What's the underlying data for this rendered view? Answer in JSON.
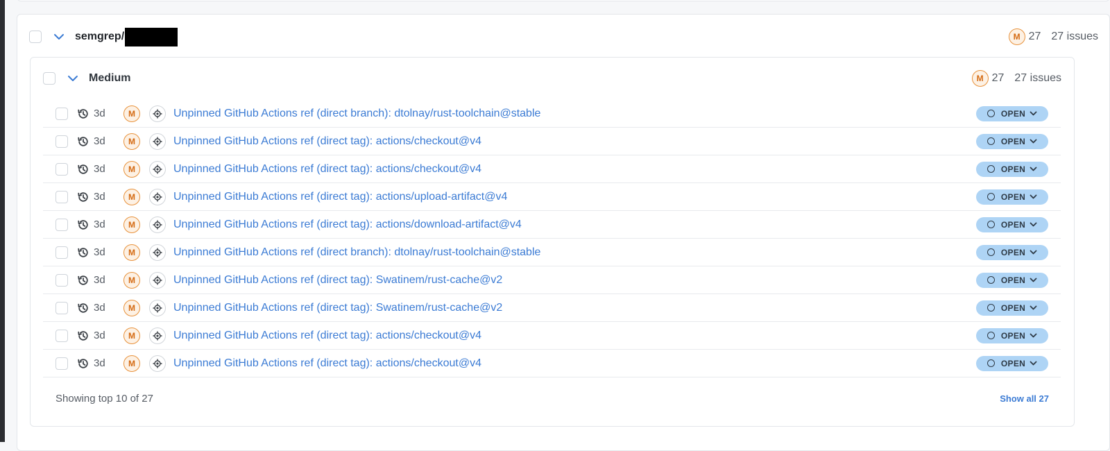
{
  "repo": {
    "name": "semgrep/",
    "severity_letter": "M",
    "count": "27",
    "issues_label": "27 issues"
  },
  "group": {
    "title": "Medium",
    "severity_letter": "M",
    "count": "27",
    "issues_label": "27 issues"
  },
  "issues": [
    {
      "age": "3d",
      "severity": "M",
      "title": "Unpinned GitHub Actions ref (direct branch): dtolnay/rust-toolchain@stable",
      "status": "OPEN"
    },
    {
      "age": "3d",
      "severity": "M",
      "title": "Unpinned GitHub Actions ref (direct tag): actions/checkout@v4",
      "status": "OPEN"
    },
    {
      "age": "3d",
      "severity": "M",
      "title": "Unpinned GitHub Actions ref (direct tag): actions/checkout@v4",
      "status": "OPEN"
    },
    {
      "age": "3d",
      "severity": "M",
      "title": "Unpinned GitHub Actions ref (direct tag): actions/upload-artifact@v4",
      "status": "OPEN"
    },
    {
      "age": "3d",
      "severity": "M",
      "title": "Unpinned GitHub Actions ref (direct tag): actions/download-artifact@v4",
      "status": "OPEN"
    },
    {
      "age": "3d",
      "severity": "M",
      "title": "Unpinned GitHub Actions ref (direct branch): dtolnay/rust-toolchain@stable",
      "status": "OPEN"
    },
    {
      "age": "3d",
      "severity": "M",
      "title": "Unpinned GitHub Actions ref (direct tag): Swatinem/rust-cache@v2",
      "status": "OPEN"
    },
    {
      "age": "3d",
      "severity": "M",
      "title": "Unpinned GitHub Actions ref (direct tag): Swatinem/rust-cache@v2",
      "status": "OPEN"
    },
    {
      "age": "3d",
      "severity": "M",
      "title": "Unpinned GitHub Actions ref (direct tag): actions/checkout@v4",
      "status": "OPEN"
    },
    {
      "age": "3d",
      "severity": "M",
      "title": "Unpinned GitHub Actions ref (direct tag): actions/checkout@v4",
      "status": "OPEN"
    }
  ],
  "footer": {
    "showing": "Showing top 10 of 27",
    "show_all": "Show all 27"
  },
  "colors": {
    "link": "#3b7bd4",
    "severity_medium": "#e8913a",
    "status_open_bg": "#aed4f5"
  },
  "icons": {
    "expand": "chevron-down-icon",
    "age": "history-icon",
    "location": "target-icon",
    "status": "circle-icon"
  }
}
